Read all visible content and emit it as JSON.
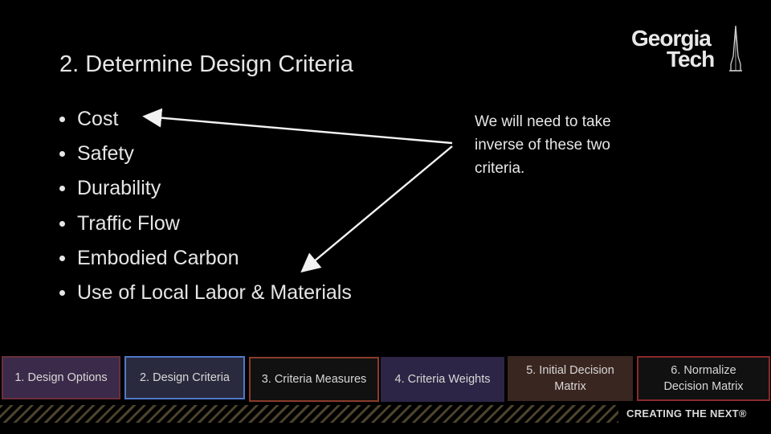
{
  "slide": {
    "title": "2. Determine Design Criteria",
    "criteria": [
      "Cost",
      "Safety",
      "Durability",
      "Traffic Flow",
      "Embodied Carbon",
      "Use of Local Labor & Materials"
    ],
    "note": "We will need to take inverse of these two criteria."
  },
  "logo": {
    "line1": "Georgia",
    "line2": "Tech"
  },
  "steps": [
    {
      "label": "1. Design Options",
      "fill": "#3b2a49",
      "border": "#6a2f3c"
    },
    {
      "label": "2. Design Criteria",
      "fill": "#2a2a3e",
      "border": "#4f78c8"
    },
    {
      "label": "3. Criteria Measures",
      "fill": "#111111",
      "border": "#8a3c2a"
    },
    {
      "label": "4. Criteria Weights",
      "fill": "#2d2545",
      "border": "#2d2545"
    },
    {
      "label": "5. Initial Decision Matrix",
      "fill": "#3a2620",
      "border": "#3a2620"
    },
    {
      "label": "6. Normalize Decision Matrix",
      "fill": "#111111",
      "border": "#8a2a2a"
    }
  ],
  "footer": {
    "tagline": "CREATING THE NEXT®"
  },
  "colors": {
    "background": "#000000",
    "text": "#e6e6e6",
    "stripe": "#8a7a52"
  }
}
